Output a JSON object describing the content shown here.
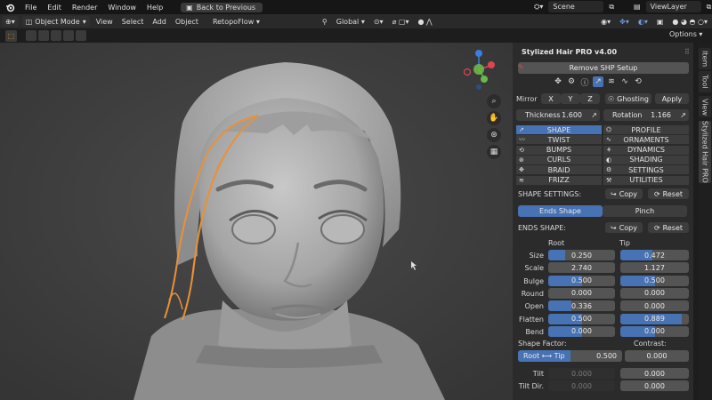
{
  "menu": [
    "File",
    "Edit",
    "Render",
    "Window",
    "Help"
  ],
  "back_button": "Back to Previous",
  "scene": "Scene",
  "viewlayer": "ViewLayer",
  "header": {
    "mode": "Object Mode",
    "items": [
      "View",
      "Select",
      "Add",
      "Object"
    ],
    "retopoflow": "RetopoFlow",
    "orientation": "Global",
    "options": "Options"
  },
  "side_tabs": [
    "Item",
    "Tool",
    "View",
    "Stylized Hair PRO"
  ],
  "panel": {
    "title": "Stylized Hair PRO v4.00",
    "remove_btn": "Remove SHP Setup",
    "mirror_label": "Mirror",
    "mirror_axes": [
      "X",
      "Y",
      "Z"
    ],
    "ghosting": "Ghosting",
    "apply": "Apply",
    "thickness_label": "Thickness",
    "thickness_value": "1.600",
    "rotation_label": "Rotation",
    "rotation_value": "1.166",
    "categories": [
      [
        "SHAPE",
        "PROFILE"
      ],
      [
        "TWIST",
        "ORNAMENTS"
      ],
      [
        "BUMPS",
        "DYNAMICS"
      ],
      [
        "CURLS",
        "SHADING"
      ],
      [
        "BRAID",
        "SETTINGS"
      ],
      [
        "FRIZZ",
        "UTILITIES"
      ]
    ],
    "shape_settings": "SHAPE SETTINGS:",
    "copy": "Copy",
    "reset": "Reset",
    "tab_ends": "Ends Shape",
    "tab_pinch": "Pinch",
    "ends_shape": "ENDS SHAPE:",
    "col_root": "Root",
    "col_tip": "Tip",
    "rows": [
      {
        "label": "Size",
        "root": "0.250",
        "root_fill": 0.25,
        "tip": "0.472",
        "tip_fill": 0.47
      },
      {
        "label": "Scale",
        "root": "2.740",
        "root_fill": 0.0,
        "tip": "1.127",
        "tip_fill": 0.0
      },
      {
        "label": "Bulge",
        "root": "0.500",
        "root_fill": 0.5,
        "tip": "0.500",
        "tip_fill": 0.5
      },
      {
        "label": "Round",
        "root": "0.000",
        "root_fill": 0.0,
        "tip": "0.000",
        "tip_fill": 0.0
      },
      {
        "label": "Open",
        "root": "0.336",
        "root_fill": 0.34,
        "tip": "0.000",
        "tip_fill": 0.0
      },
      {
        "label": "Flatten",
        "root": "0.500",
        "root_fill": 0.5,
        "tip": "0.889",
        "tip_fill": 0.89
      },
      {
        "label": "Bend",
        "root": "0.000",
        "root_fill": 0.5,
        "tip": "0.000",
        "tip_fill": 0.5
      }
    ],
    "shape_factor": "Shape Factor:",
    "contrast": "Contrast:",
    "root_tip_label": "Root ⟷ Tip",
    "root_tip_value": "0.500",
    "root_tip_fill": 0.5,
    "contrast_value": "0.000",
    "tilt_label": "Tilt",
    "tilt_root": "0.000",
    "tilt_tip": "0.000",
    "tiltdir_label": "Tilt Dir.",
    "tiltdir_root": "0.000",
    "tiltdir_tip": "0.000"
  },
  "colors": {
    "accent": "#4772b3",
    "hair_outline": "#e8913a",
    "axis_x": "#e0444e",
    "axis_y": "#6ab84a",
    "axis_z": "#3b7de0"
  }
}
